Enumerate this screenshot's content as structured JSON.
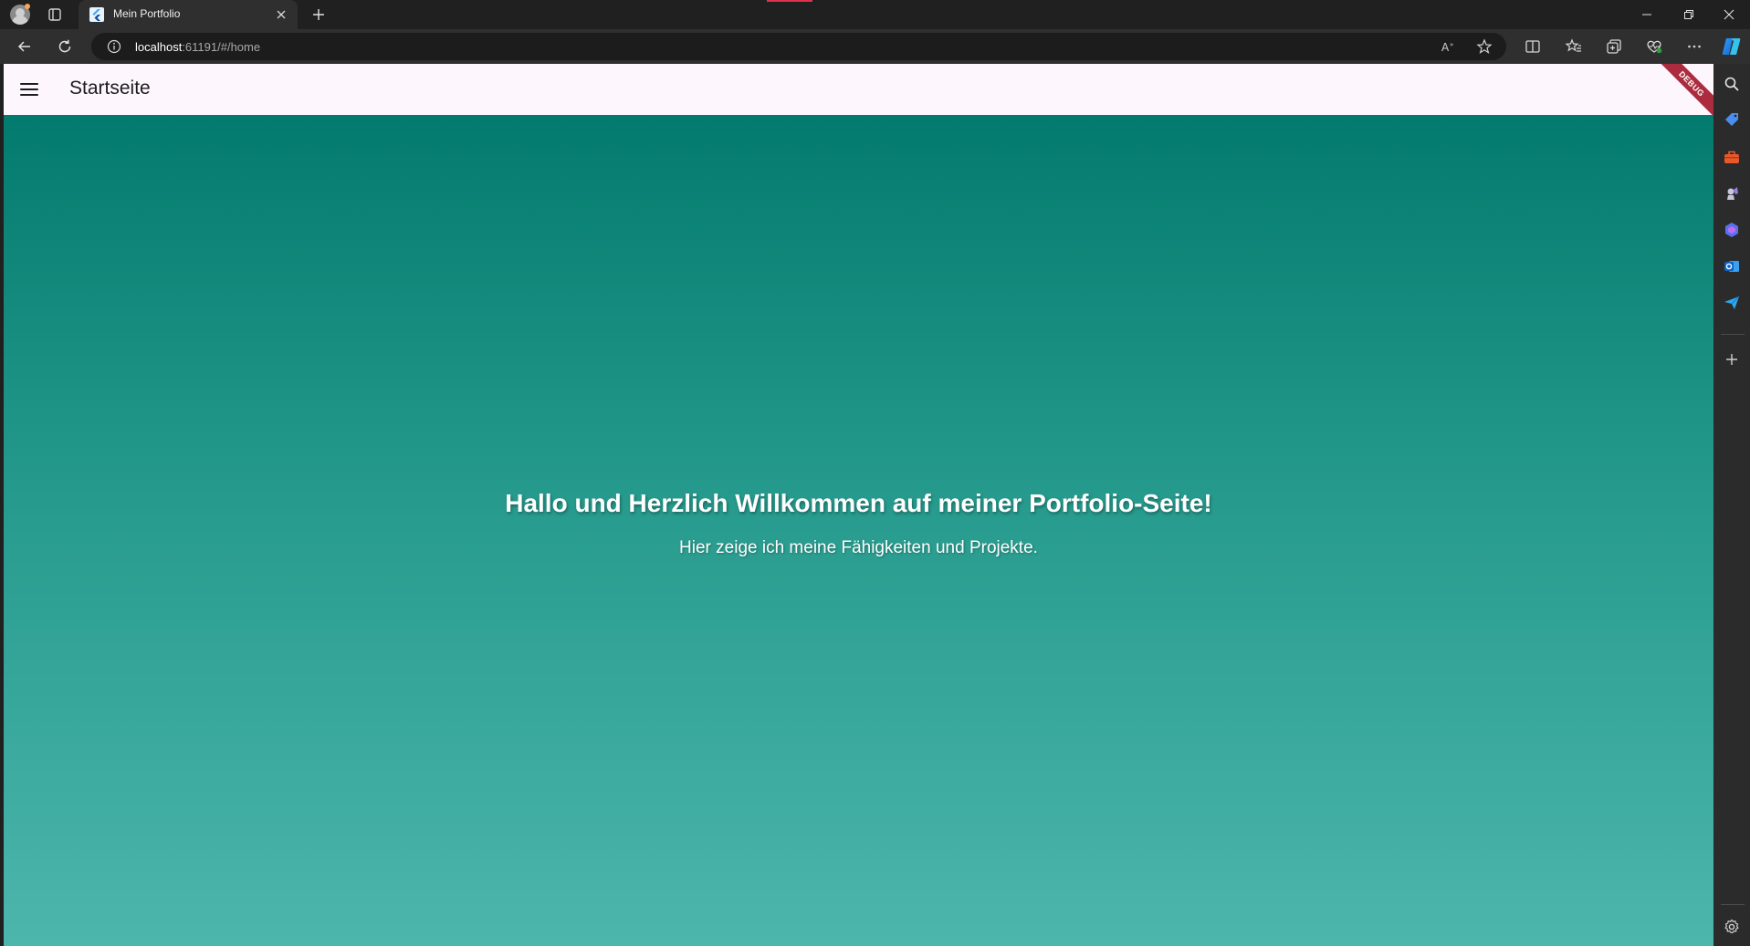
{
  "browser": {
    "tab": {
      "title": "Mein Portfolio",
      "favicon": "flutter-icon"
    },
    "address": {
      "host": "localhost",
      "rest": ":61191/#/home"
    },
    "icons": {
      "back": "arrow-left-icon",
      "reload": "reload-icon",
      "info": "info-icon",
      "read_aloud": "read-aloud-icon",
      "favorite": "star-icon",
      "split": "split-screen-icon",
      "favorites": "favorites-icon",
      "collections": "collections-icon",
      "performance": "heart-pulse-icon",
      "more": "more-icon",
      "copilot": "copilot-icon"
    },
    "sidebar_icons": [
      "search-icon",
      "tag-icon",
      "toolbox-icon",
      "chess-icon",
      "microsoft365-icon",
      "outlook-icon",
      "send-icon",
      "plus-icon",
      "settings-icon"
    ]
  },
  "app": {
    "appbar_title": "Startseite",
    "debug_label": "DEBUG",
    "hero": {
      "title": "Hallo und Herzlich Willkommen auf meiner Portfolio-Seite!",
      "subtitle": "Hier zeige ich meine Fähigkeiten und Projekte."
    },
    "colors": {
      "gradient_top": "#027a6d",
      "gradient_bottom": "#4db6ac",
      "appbar_bg": "#fdf6fd",
      "debug_banner": "#a3172a"
    }
  }
}
